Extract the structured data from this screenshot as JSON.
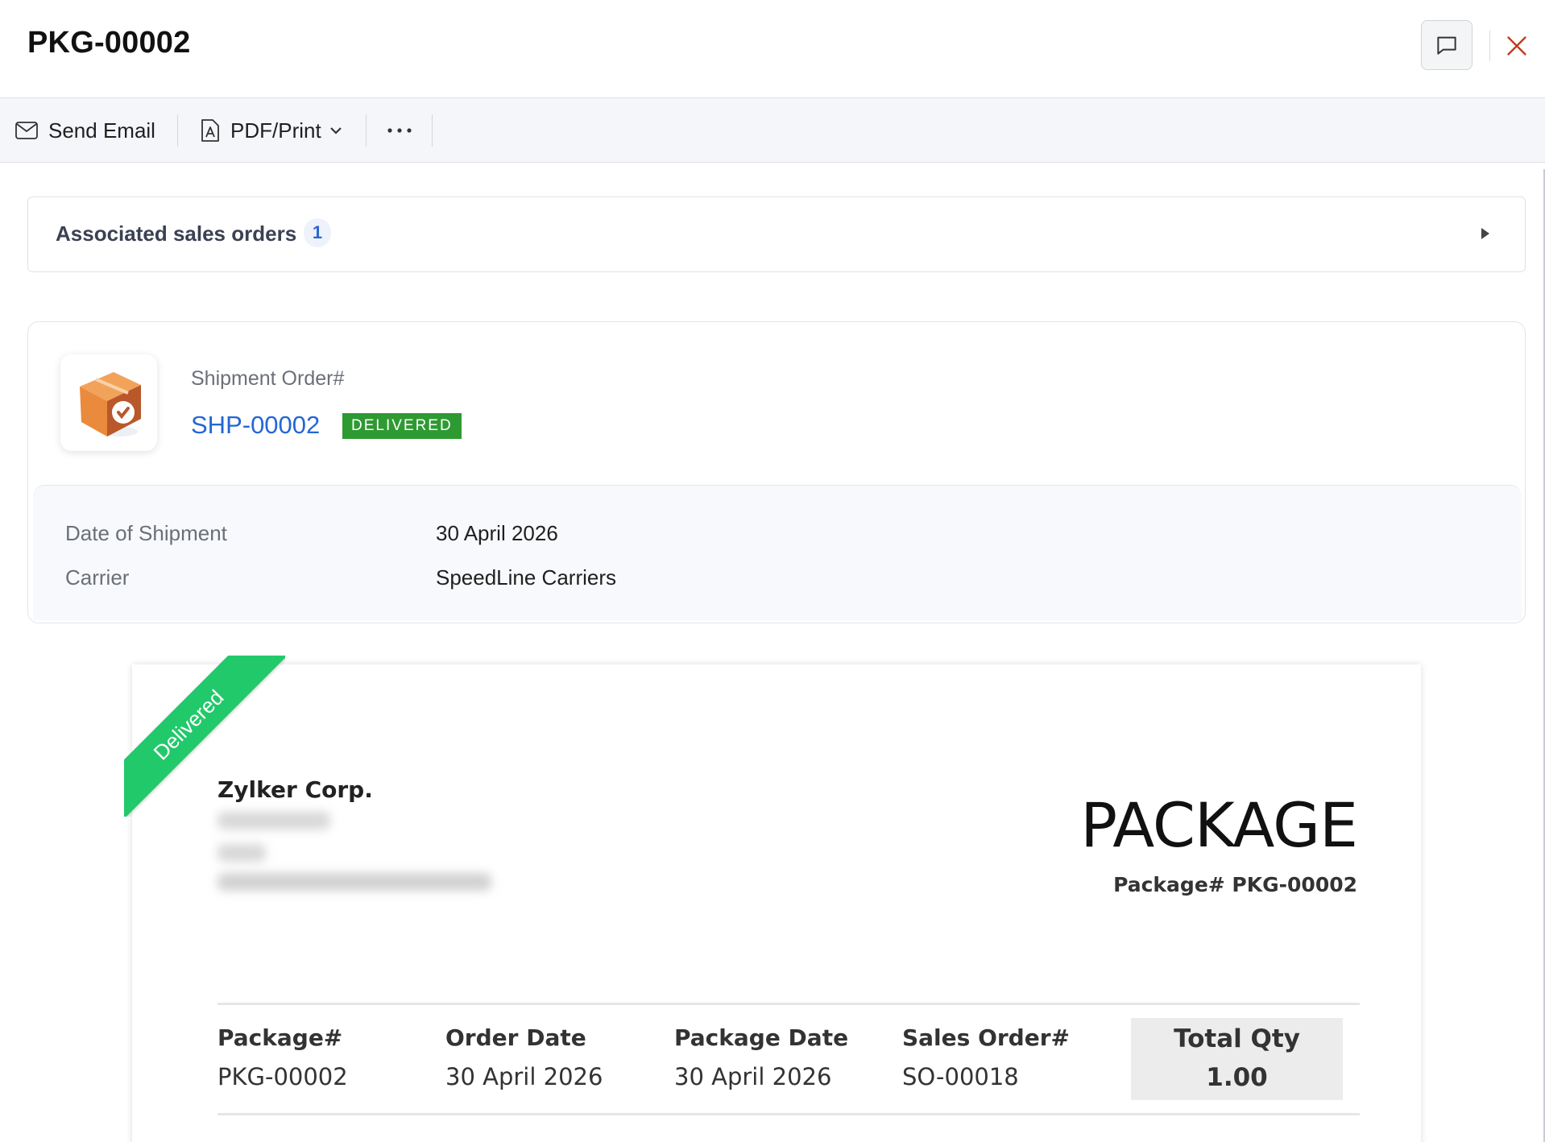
{
  "header": {
    "title": "PKG-00002",
    "comment_icon": "comment-icon",
    "close_icon": "close-icon",
    "close_color": "#c0391b"
  },
  "toolbar": {
    "send_email_label": "Send Email",
    "pdf_print_label": "PDF/Print",
    "more_label": "···"
  },
  "associated": {
    "label": "Associated sales orders",
    "count": "1"
  },
  "shipment": {
    "label": "Shipment Order#",
    "number": "SHP-00002",
    "status": "DELIVERED",
    "status_color": "#2e9a32",
    "details": [
      {
        "label": "Date of Shipment",
        "value": "30 April 2026"
      },
      {
        "label": "Carrier",
        "value": "SpeedLine Carriers"
      }
    ]
  },
  "document": {
    "ribbon": "Delivered",
    "company": "Zylker Corp.",
    "title": "PACKAGE",
    "package_no": "Package# PKG-00002",
    "columns": [
      {
        "header": "Package#",
        "value": "PKG-00002"
      },
      {
        "header": "Order Date",
        "value": "30 April 2026"
      },
      {
        "header": "Package Date",
        "value": "30 April 2026"
      },
      {
        "header": "Sales Order#",
        "value": "SO-00018"
      }
    ],
    "total_qty": {
      "header": "Total Qty",
      "value": "1.00"
    }
  },
  "colors": {
    "link": "#2467d4",
    "ribbon": "#22c96a"
  }
}
